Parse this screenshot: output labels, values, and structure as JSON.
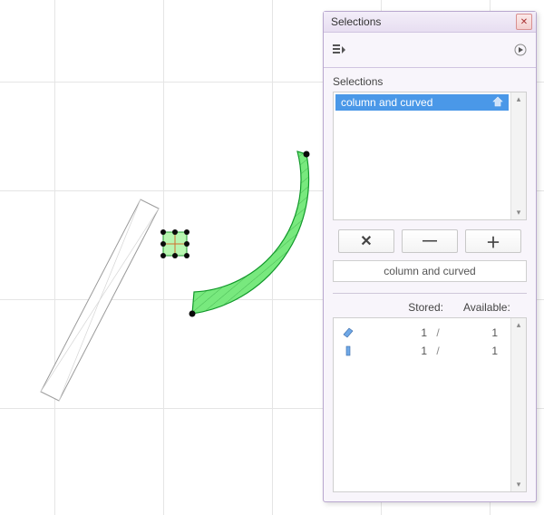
{
  "palette": {
    "title": "Selections",
    "section_label": "Selections",
    "close_glyph": "✕",
    "flyout_glyph": "▸",
    "list_items": [
      {
        "label": "column and curved",
        "selected": true
      }
    ],
    "scroll_up": "▴",
    "scroll_down": "▾",
    "buttons": {
      "delete_glyph": "✕",
      "remove_glyph": "—",
      "add_glyph": "＋"
    },
    "name_field": "column and curved",
    "stored_header": {
      "stored": "Stored:",
      "available": "Available:"
    },
    "stored_rows": [
      {
        "icon": "wall-icon",
        "stored": "1",
        "slash": "/",
        "available": "1"
      },
      {
        "icon": "column-icon",
        "stored": "1",
        "slash": "/",
        "available": "1"
      }
    ]
  }
}
